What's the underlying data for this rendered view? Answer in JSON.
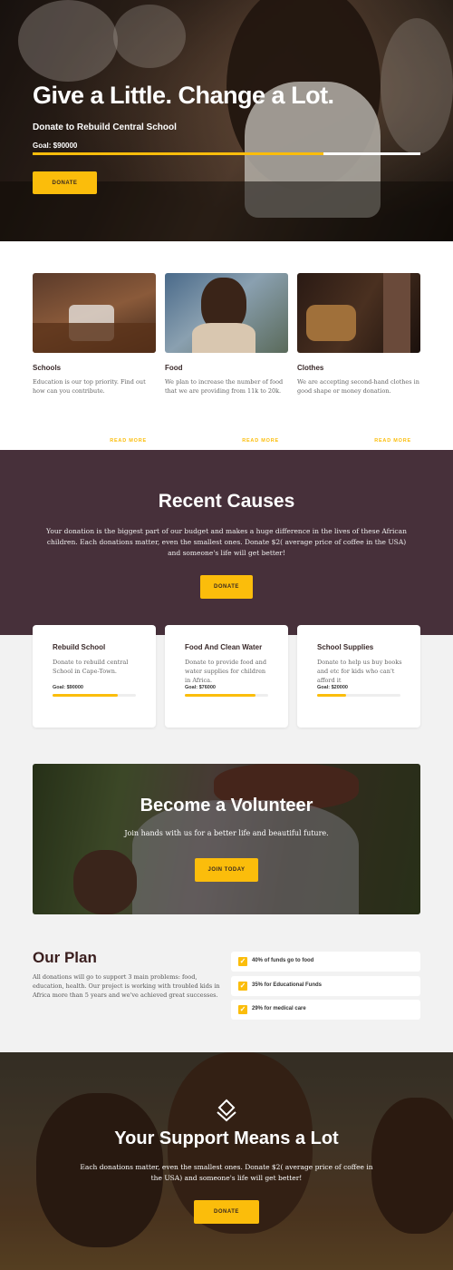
{
  "hero": {
    "title": "Give a Little. Change a Lot.",
    "subtitle": "Donate to Rebuild Central School",
    "goal": "Goal: $90000",
    "progress": 0.75,
    "button": "DONATE"
  },
  "categories": [
    {
      "title": "Schools",
      "text": "Education is our top priority. Find out how can you contribute.",
      "link": "READ MORE"
    },
    {
      "title": "Food",
      "text": "We plan to increase the number of food that we are providing from 11k to 20k.",
      "link": "READ MORE"
    },
    {
      "title": "Clothes",
      "text": "We are accepting second-hand clothes in good shape or money donation.",
      "link": "READ MORE"
    }
  ],
  "causes": {
    "title": "Recent Causes",
    "text": "Your donation is the biggest part of our budget and makes a huge difference in the lives of these African children. Each donations matter, even the smallest ones. Donate $2( average price of coffee in the USA) and someone's life will get better!",
    "button": "DONATE",
    "items": [
      {
        "title": "Rebuild School",
        "text": "Donate to rebuild central School in Cape-Town.",
        "goal": "Goal: $90000",
        "progress": 0.78
      },
      {
        "title": "Food And Clean Water",
        "text": "Donate to provide food and water supplies for children in Africa.",
        "goal": "Goal: $76000",
        "progress": 0.85
      },
      {
        "title": "School Supplies",
        "text": "Donate to help us buy books and etc for kids who can't afford it",
        "goal": "Goal: $20000",
        "progress": 0.35
      }
    ]
  },
  "volunteer": {
    "title": "Become a Volunteer",
    "subtitle": "Join hands with us for a better life and beautiful future.",
    "button": "JOIN TODAY"
  },
  "plan": {
    "title": "Our Plan",
    "text": "All donations will go to support 3 main problems: food, education, health. Our project is working with troubled kids in Africa more than 5 years and we've achieved great successes.",
    "items": [
      "40% of funds go to food",
      "35% for Educational Funds",
      "29% for medical care"
    ]
  },
  "support": {
    "title": "Your Support Means a Lot",
    "text": "Each donations matter, even the smallest ones. Donate $2( average price of coffee in the USA) and someone's life will get better!",
    "button": "DONATE"
  },
  "colors": {
    "accent": "#fbbd0b",
    "plum": "#47303a",
    "dark_text": "#3a1e1e"
  }
}
